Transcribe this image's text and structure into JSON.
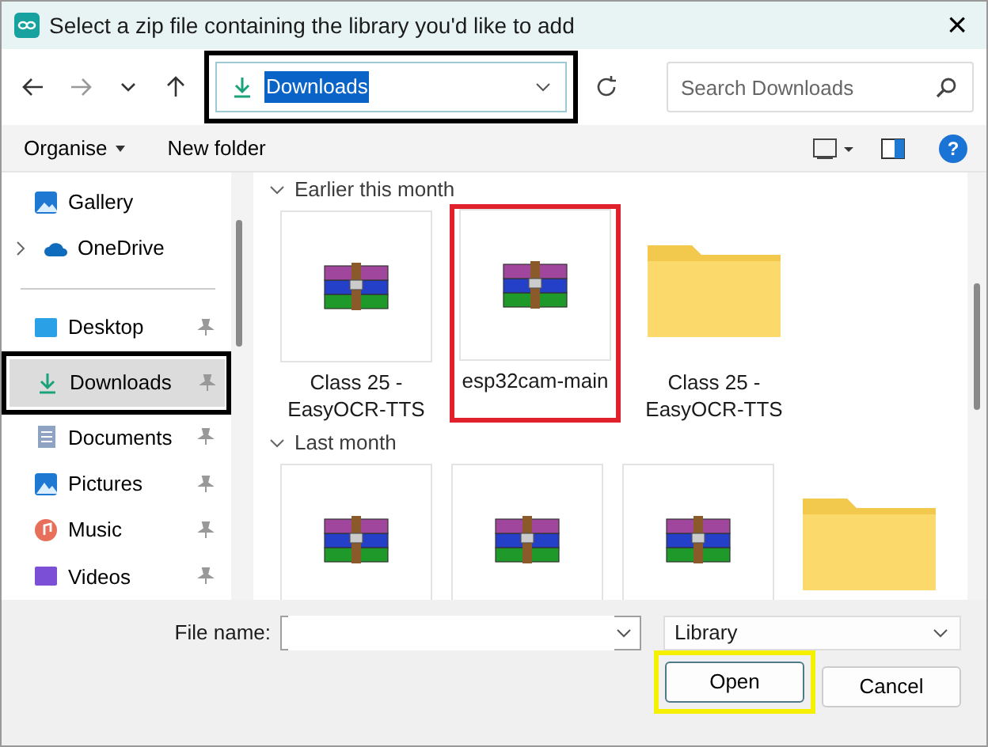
{
  "window": {
    "title": "Select a zip file containing the library you'd like to add",
    "close": "×"
  },
  "address_bar": {
    "path": "Downloads",
    "path_selected": true,
    "highlighted": true
  },
  "search": {
    "placeholder": "Search Downloads"
  },
  "toolbar": {
    "organise": "Organise",
    "new_folder": "New folder",
    "help": "?"
  },
  "sidebar": {
    "groups": [
      [
        {
          "label": "Gallery",
          "kind": "gallery",
          "pinned": false,
          "expandable": false,
          "selected": false
        },
        {
          "label": "OneDrive",
          "kind": "cloud",
          "pinned": false,
          "expandable": true,
          "selected": false
        }
      ],
      [
        {
          "label": "Desktop",
          "kind": "desktop",
          "pinned": true,
          "expandable": false,
          "selected": false
        },
        {
          "label": "Downloads",
          "kind": "download",
          "pinned": true,
          "expandable": false,
          "selected": true,
          "highlighted": true
        },
        {
          "label": "Documents",
          "kind": "document",
          "pinned": true,
          "expandable": false,
          "selected": false
        },
        {
          "label": "Pictures",
          "kind": "pictures",
          "pinned": true,
          "expandable": false,
          "selected": false
        },
        {
          "label": "Music",
          "kind": "music",
          "pinned": true,
          "expandable": false,
          "selected": false
        },
        {
          "label": "Videos",
          "kind": "video",
          "pinned": true,
          "expandable": false,
          "selected": false
        }
      ]
    ]
  },
  "sections": [
    {
      "title": "Earlier this month",
      "expanded": true,
      "files": [
        {
          "name": "Class 25 - EasyOCR-TTS",
          "kind": "archive"
        },
        {
          "name": "esp32cam-main",
          "kind": "archive",
          "highlighted": true
        },
        {
          "name": "Class 25 - EasyOCR-TTS",
          "kind": "folder"
        }
      ]
    },
    {
      "title": "Last month",
      "expanded": true,
      "files": [
        {
          "kind": "archive"
        },
        {
          "kind": "archive"
        },
        {
          "kind": "archive"
        },
        {
          "kind": "folder"
        }
      ]
    }
  ],
  "footer": {
    "file_name_label": "File name:",
    "file_type": "Library",
    "buttons": [
      {
        "label": "Open",
        "default": true,
        "highlighted": true
      },
      {
        "label": "Cancel",
        "default": false
      }
    ]
  }
}
